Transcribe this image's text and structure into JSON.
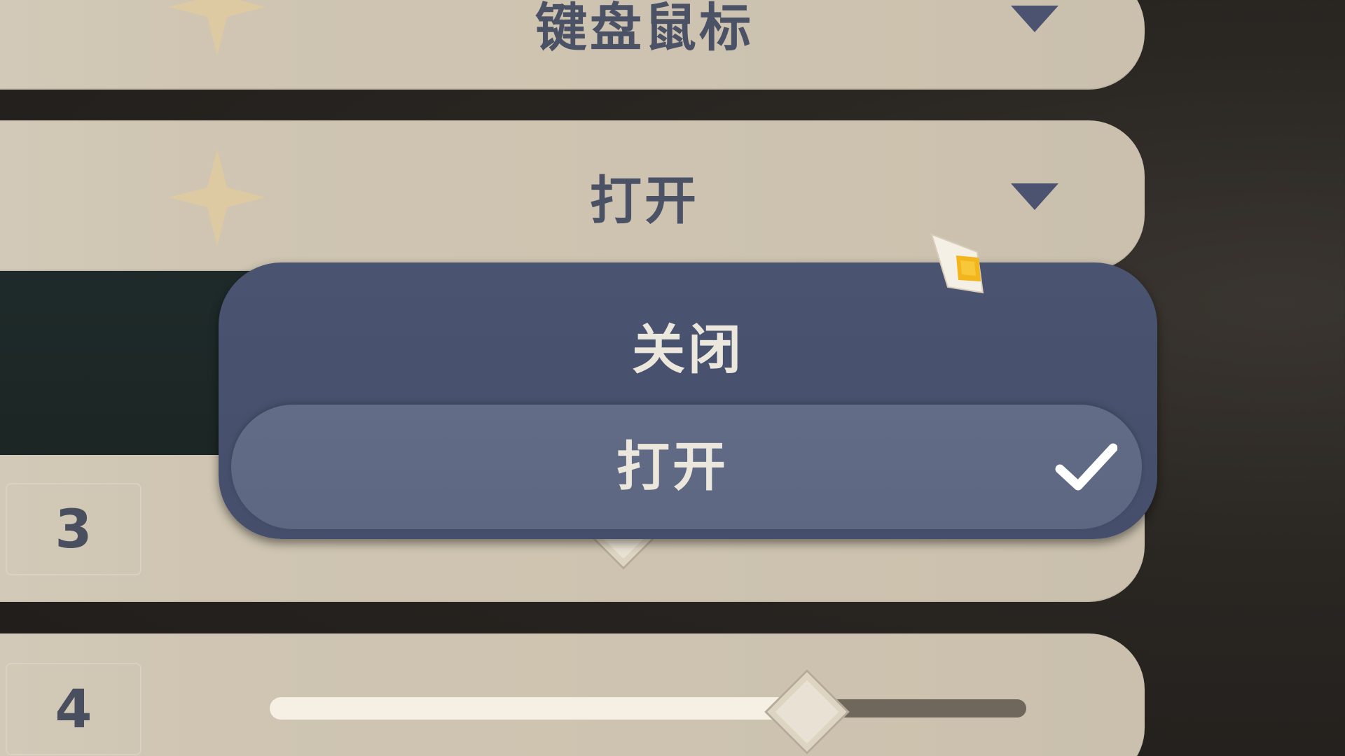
{
  "settings": {
    "device_row": {
      "value": "键盘鼠标"
    },
    "toggle_row": {
      "value": "打开"
    },
    "row_3": {
      "number": "3",
      "slider_level": 0.5
    },
    "row_4": {
      "number": "4",
      "slider_level": 0.73
    }
  },
  "dropdown": {
    "options": [
      {
        "label": "关闭",
        "selected": false
      },
      {
        "label": "打开",
        "selected": true
      }
    ]
  },
  "icons": {
    "dropdown_arrow": "triangle-down",
    "check": "checkmark",
    "cursor": "star-pointer"
  },
  "colors": {
    "panel": "#cdc3b0",
    "text_dark": "#4b5265",
    "dropdown_bg": "#4a5470",
    "dropdown_selected": "#626c86",
    "cursor_accent": "#f2b51c"
  }
}
